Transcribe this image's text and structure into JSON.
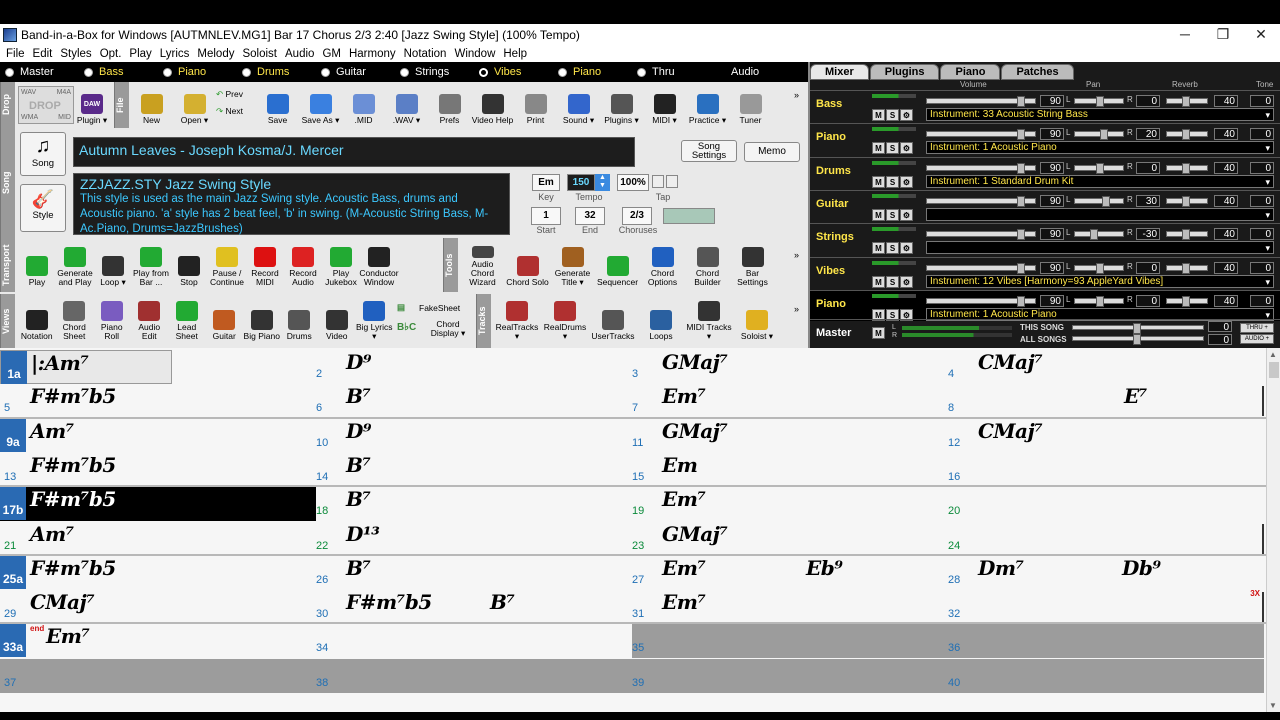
{
  "window": {
    "title": "Band-in-a-Box for Windows  [AUTMNLEV.MG1] Bar 17 Chorus 2/3   2:40  [Jazz Swing Style] (100% Tempo)"
  },
  "menu": [
    "File",
    "Edit",
    "Styles",
    "Opt.",
    "Play",
    "Lyrics",
    "Melody",
    "Soloist",
    "Audio",
    "GM",
    "Harmony",
    "Notation",
    "Window",
    "Help"
  ],
  "tracks": [
    {
      "label": "Master",
      "color": "white",
      "dot": "filled"
    },
    {
      "label": "Bass",
      "color": "yellow",
      "dot": "filled"
    },
    {
      "label": "Piano",
      "color": "yellow",
      "dot": "filled"
    },
    {
      "label": "Drums",
      "color": "yellow",
      "dot": "filled"
    },
    {
      "label": "Guitar",
      "color": "white",
      "dot": "filled"
    },
    {
      "label": "Strings",
      "color": "white",
      "dot": "filled"
    },
    {
      "label": "Vibes",
      "color": "yellow",
      "dot": "ring"
    },
    {
      "label": "Piano",
      "color": "yellow",
      "dot": "filled"
    },
    {
      "label": "Thru",
      "color": "white",
      "dot": "filled"
    },
    {
      "label": "Audio",
      "color": "white",
      "dot": "none"
    }
  ],
  "side_labels": {
    "drop": "Drop",
    "file": "File",
    "song": "Song",
    "transport": "Transport",
    "tools": "Tools",
    "views": "Views",
    "tracks": "Tracks"
  },
  "drop": {
    "wav": "WAV",
    "drop": "DROP",
    "m4a": "M4A",
    "wma": "WMA",
    "mid": "MID",
    "daw": "DAW",
    "plugin": "Plugin ▾"
  },
  "file_toolbar": [
    {
      "label": "New",
      "icon": "new-file-icon",
      "color": "#c9a020"
    },
    {
      "label": "Open ▾",
      "icon": "open-folder-icon",
      "color": "#d4b030"
    },
    {
      "label": "Save",
      "icon": "save-disk-icon",
      "color": "#2a6fd0"
    },
    {
      "label": "Save As ▾",
      "icon": "save-as-icon",
      "color": "#3a80e0"
    },
    {
      "label": ".MID",
      "icon": "midi-file-icon",
      "color": "#6b8fd6"
    },
    {
      "label": ".WAV ▾",
      "icon": "wav-file-icon",
      "color": "#5b7fc6"
    },
    {
      "label": "Prefs",
      "icon": "gear-icon",
      "color": "#777"
    },
    {
      "label": "Video Help",
      "icon": "film-icon",
      "color": "#333"
    },
    {
      "label": "Print",
      "icon": "printer-icon",
      "color": "#888"
    },
    {
      "label": "Sound ▾",
      "icon": "speaker-icon",
      "color": "#3366cc"
    },
    {
      "label": "Plugins ▾",
      "icon": "plugins-icon",
      "color": "#555"
    },
    {
      "label": "MIDI ▾",
      "icon": "midi-port-icon",
      "color": "#222"
    },
    {
      "label": "Practice ▾",
      "icon": "practice-icon",
      "color": "#2a70c0"
    },
    {
      "label": "Tuner",
      "icon": "tuner-icon",
      "color": "#999"
    }
  ],
  "prevnext": {
    "prev": "Prev",
    "next": "Next"
  },
  "song_buttons": {
    "song": "Song",
    "style": "Style",
    "song_settings": "Song Settings",
    "memo": "Memo"
  },
  "song": {
    "title": "Autumn Leaves - Joseph Kosma/J. Mercer",
    "style_name": "ZZJAZZ.STY Jazz Swing Style",
    "style_desc": "This style is used as the main Jazz Swing style.  Acoustic Bass, drums and Acoustic piano. 'a' style has 2 beat feel, 'b' in swing.    (M-Acoustic String Bass, M-Ac.Piano, Drums=JazzBrushes)"
  },
  "song_fields": {
    "key": "Em",
    "tempo": "150",
    "tempo_pct": "100%",
    "start": "1",
    "end": "32",
    "choruses": "2/3",
    "key_label": "Key",
    "tempo_label": "Tempo",
    "tap_label": "Tap",
    "start_label": "Start",
    "end_label": "End",
    "choruses_label": "Choruses"
  },
  "transport": [
    {
      "label": "Play",
      "icon": "play-icon",
      "color": "#22aa33"
    },
    {
      "label": "Generate and Play",
      "icon": "generate-play-icon",
      "color": "#22aa33"
    },
    {
      "label": "Loop ▾",
      "icon": "loop-icon",
      "color": "#333"
    },
    {
      "label": "Play from Bar ...",
      "icon": "play-from-bar-icon",
      "color": "#22aa33"
    },
    {
      "label": "Stop",
      "icon": "stop-icon",
      "color": "#222"
    },
    {
      "label": "Pause / Continue",
      "icon": "pause-icon",
      "color": "#e0c020"
    },
    {
      "label": "Record MIDI",
      "icon": "record-midi-icon",
      "color": "#dd1111"
    },
    {
      "label": "Record Audio",
      "icon": "record-audio-icon",
      "color": "#dd2222"
    },
    {
      "label": "Play Jukebox",
      "icon": "jukebox-icon",
      "color": "#22aa33"
    },
    {
      "label": "Conductor Window",
      "icon": "conductor-icon",
      "color": "#222"
    }
  ],
  "tools": [
    {
      "label": "Audio Chord Wizard",
      "icon": "chord-wizard-icon",
      "color": "#444"
    },
    {
      "label": "Chord Solo",
      "icon": "chord-solo-icon",
      "color": "#b03030"
    },
    {
      "label": "Generate Title ▾",
      "icon": "generate-title-icon",
      "color": "#a06020"
    },
    {
      "label": "Sequencer",
      "icon": "sequencer-icon",
      "color": "#22aa33"
    },
    {
      "label": "Chord Options",
      "icon": "chord-options-icon",
      "color": "#2060c0"
    },
    {
      "label": "Chord Builder",
      "icon": "chord-builder-icon",
      "color": "#555"
    },
    {
      "label": "Bar Settings",
      "icon": "bar-settings-icon",
      "color": "#333"
    }
  ],
  "views": [
    {
      "label": "Notation",
      "icon": "note-icon",
      "color": "#222"
    },
    {
      "label": "Chord Sheet",
      "icon": "chord-sheet-icon",
      "color": "#666"
    },
    {
      "label": "Piano Roll",
      "icon": "piano-roll-icon",
      "color": "#7a5cc0"
    },
    {
      "label": "Audio Edit",
      "icon": "audio-edit-icon",
      "color": "#a03030"
    },
    {
      "label": "Lead Sheet",
      "icon": "lead-sheet-icon",
      "color": "#22aa33"
    },
    {
      "label": "Guitar",
      "icon": "guitar-icon",
      "color": "#c05a20"
    },
    {
      "label": "Big Piano",
      "icon": "big-piano-icon",
      "color": "#333"
    },
    {
      "label": "Drums",
      "icon": "drums-icon",
      "color": "#555"
    },
    {
      "label": "Video",
      "icon": "video-icon",
      "color": "#333"
    },
    {
      "label": "Big Lyrics ▾",
      "icon": "big-lyrics-icon",
      "color": "#2060c0"
    }
  ],
  "fakesheet": {
    "label": "FakeSheet",
    "chord_display": "Chord Display ▾"
  },
  "tracks_tools": [
    {
      "label": "RealTracks ▾",
      "icon": "realtracks-icon",
      "color": "#b03030"
    },
    {
      "label": "RealDrums ▾",
      "icon": "realdrums-icon",
      "color": "#b03030"
    },
    {
      "label": "UserTracks",
      "icon": "usertracks-icon",
      "color": "#555"
    },
    {
      "label": "Loops",
      "icon": "loops-icon",
      "color": "#2a60a0"
    },
    {
      "label": "MIDI Tracks ▾",
      "icon": "midi-tracks-icon",
      "color": "#333"
    },
    {
      "label": "Soloist ▾",
      "icon": "soloist-icon",
      "color": "#e0b020"
    }
  ],
  "mixer": {
    "tabs": [
      "Mixer",
      "Plugins",
      "Piano",
      "Patches"
    ],
    "headers": {
      "volume": "Volume",
      "pan": "Pan",
      "reverb": "Reverb",
      "tone": "Tone"
    },
    "rows": [
      {
        "name": "Bass",
        "volume": "90",
        "pan": "0",
        "reverb": "40",
        "tone": "0",
        "vol": 0.9,
        "panf": 0.5,
        "revf": 0.45,
        "instrument": "Instrument: 33 Acoustic String Bass"
      },
      {
        "name": "Piano",
        "volume": "90",
        "pan": "20",
        "reverb": "40",
        "tone": "0",
        "vol": 0.9,
        "panf": 0.6,
        "revf": 0.45,
        "instrument": "Instrument: 1 Acoustic Piano"
      },
      {
        "name": "Drums",
        "volume": "90",
        "pan": "0",
        "reverb": "40",
        "tone": "0",
        "vol": 0.9,
        "panf": 0.5,
        "revf": 0.45,
        "instrument": "Instrument: 1 Standard Drum Kit"
      },
      {
        "name": "Guitar",
        "volume": "90",
        "pan": "30",
        "reverb": "40",
        "tone": "0",
        "vol": 0.9,
        "panf": 0.65,
        "revf": 0.45,
        "instrument": ""
      },
      {
        "name": "Strings",
        "volume": "90",
        "pan": "-30",
        "reverb": "40",
        "tone": "0",
        "vol": 0.9,
        "panf": 0.35,
        "revf": 0.45,
        "instrument": ""
      },
      {
        "name": "Vibes",
        "volume": "90",
        "pan": "0",
        "reverb": "40",
        "tone": "0",
        "vol": 0.9,
        "panf": 0.5,
        "revf": 0.45,
        "instrument": "Instrument: 12 Vibes  [Harmony=93 AppleYard Vibes]"
      },
      {
        "name": "Piano",
        "volume": "90",
        "pan": "0",
        "reverb": "40",
        "tone": "0",
        "vol": 0.9,
        "panf": 0.5,
        "revf": 0.45,
        "instrument": "Instrument: 1 Acoustic Piano"
      }
    ],
    "master": {
      "label": "Master",
      "this_song": "THIS SONG",
      "all_songs": "ALL SONGS",
      "this_val": "0",
      "all_val": "0",
      "thru": "THRU +",
      "audio": "AUDIO +"
    }
  },
  "chord_grid": {
    "rows": [
      {
        "cells": [
          {
            "num": "1a",
            "part": true,
            "chord": "|:Am⁷"
          },
          {
            "num": "2",
            "chord": "D⁹"
          },
          {
            "num": "3",
            "chord": "GMaj⁷"
          },
          {
            "num": "4",
            "chord": "CMaj⁷"
          }
        ]
      },
      {
        "cells": [
          {
            "num": "5",
            "chord": "F#m⁷b5"
          },
          {
            "num": "6",
            "chord": "B⁷"
          },
          {
            "num": "7",
            "chord": "Em⁷"
          },
          {
            "num": "8",
            "chord": "",
            "chord2": "E⁷"
          }
        ]
      },
      {
        "cells": [
          {
            "num": "9a",
            "part": true,
            "chord": "Am⁷"
          },
          {
            "num": "10",
            "chord": "D⁹"
          },
          {
            "num": "11",
            "chord": "GMaj⁷"
          },
          {
            "num": "12",
            "chord": "CMaj⁷"
          }
        ]
      },
      {
        "cells": [
          {
            "num": "13",
            "chord": "F#m⁷b5"
          },
          {
            "num": "14",
            "chord": "B⁷"
          },
          {
            "num": "15",
            "chord": "Em"
          },
          {
            "num": "16",
            "chord": ""
          }
        ]
      },
      {
        "cells": [
          {
            "num": "17b",
            "part": true,
            "green": true,
            "current": true,
            "chord": "F#m⁷b5"
          },
          {
            "num": "18",
            "green": true,
            "chord": "B⁷"
          },
          {
            "num": "19",
            "green": true,
            "chord": "Em⁷"
          },
          {
            "num": "20",
            "green": true,
            "chord": ""
          }
        ]
      },
      {
        "cells": [
          {
            "num": "21",
            "green": true,
            "chord": "Am⁷"
          },
          {
            "num": "22",
            "green": true,
            "chord": "D¹³"
          },
          {
            "num": "23",
            "green": true,
            "chord": "GMaj⁷"
          },
          {
            "num": "24",
            "green": true,
            "chord": ""
          }
        ]
      },
      {
        "cells": [
          {
            "num": "25a",
            "part": true,
            "chord": "F#m⁷b5"
          },
          {
            "num": "26",
            "chord": "B⁷"
          },
          {
            "num": "27",
            "chord": "Em⁷",
            "chord2": "Eb⁹"
          },
          {
            "num": "28",
            "chord": "Dm⁷",
            "chord2": "Db⁹"
          }
        ]
      },
      {
        "cells": [
          {
            "num": "29",
            "chord": "CMaj⁷"
          },
          {
            "num": "30",
            "chord": "F#m⁷b5",
            "chord2": "B⁷"
          },
          {
            "num": "31",
            "chord": "Em⁷"
          },
          {
            "num": "32",
            "chord": "",
            "repeat": "3X"
          }
        ]
      },
      {
        "cells": [
          {
            "num": "33a",
            "part": true,
            "chord": "Em⁷",
            "end": "end"
          },
          {
            "num": "34",
            "chord": ""
          },
          {
            "num": "35",
            "chord": ""
          },
          {
            "num": "36",
            "chord": ""
          }
        ]
      },
      {
        "cells": [
          {
            "num": "37",
            "chord": ""
          },
          {
            "num": "38",
            "chord": ""
          },
          {
            "num": "39",
            "chord": ""
          },
          {
            "num": "40",
            "chord": ""
          }
        ]
      }
    ]
  }
}
